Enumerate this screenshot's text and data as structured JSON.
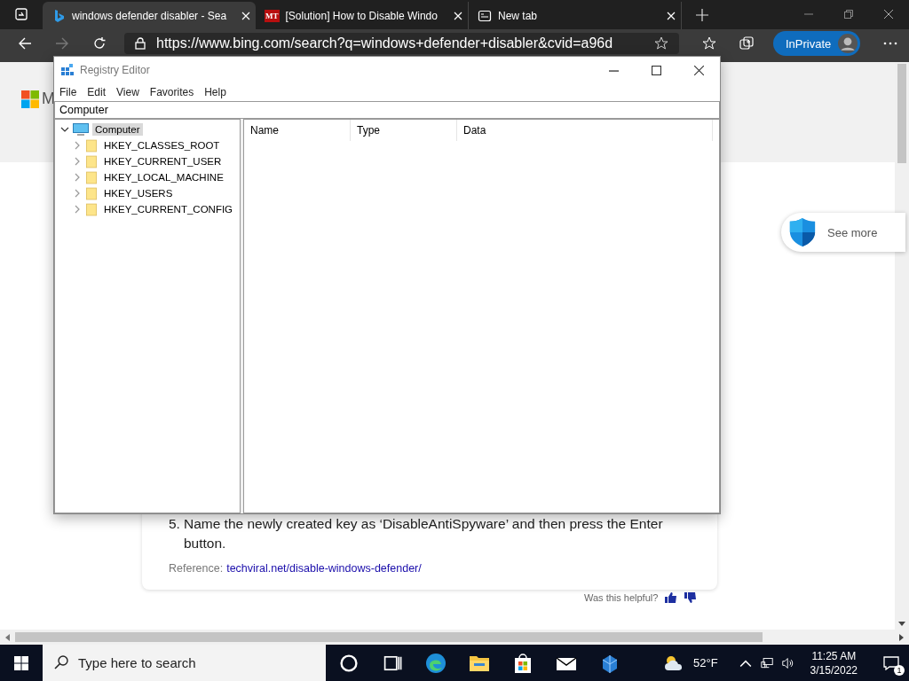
{
  "browser": {
    "tabs": [
      {
        "title": "windows defender disabler - Sea",
        "kind": "bing",
        "selected": true
      },
      {
        "title": "[Solution] How to Disable Windo",
        "kind": "mt",
        "icon_text": "MT",
        "selected": false
      },
      {
        "title": "New tab",
        "kind": "newtab",
        "selected": false
      }
    ],
    "address": "https://www.bing.com/search?q=windows+defender+disabler&cvid=a96d",
    "inprivate": "InPrivate"
  },
  "page": {
    "logo_text": "M",
    "see_more": "See more",
    "step": {
      "number": "5.",
      "text": "Name the newly created key as ‘DisableAntiSpyware’ and then press the Enter button."
    },
    "reference_label": "Reference:",
    "reference_link": "techviral.net/disable-windows-defender/",
    "helpful": "Was this helpful?"
  },
  "registry": {
    "title": "Registry Editor",
    "menu": [
      "File",
      "Edit",
      "View",
      "Favorites",
      "Help"
    ],
    "address": "Computer",
    "tree": {
      "label": "Computer",
      "expanded": true,
      "selected": true,
      "children": [
        {
          "label": "HKEY_CLASSES_ROOT",
          "expanded": false
        },
        {
          "label": "HKEY_CURRENT_USER",
          "expanded": false
        },
        {
          "label": "HKEY_LOCAL_MACHINE",
          "expanded": false
        },
        {
          "label": "HKEY_USERS",
          "expanded": false
        },
        {
          "label": "HKEY_CURRENT_CONFIG",
          "expanded": false
        }
      ]
    },
    "columns": [
      "Name",
      "Type",
      "Data"
    ]
  },
  "taskbar": {
    "search_placeholder": "Type here to search",
    "temperature": "52°F",
    "time": "11:25 AM",
    "date": "3/15/2022",
    "notifications": "1"
  }
}
